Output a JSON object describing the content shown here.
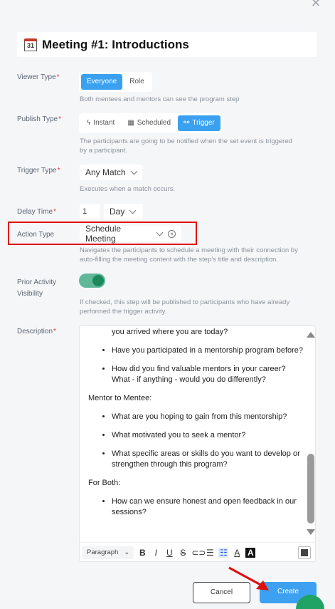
{
  "header": {
    "title": "Meeting #1: Introductions",
    "calendar_day": "31"
  },
  "viewer_type": {
    "label": "Viewer Type",
    "options": [
      "Everyone",
      "Role"
    ],
    "selected": "Everyone",
    "help": "Both mentees and mentors can see the program step"
  },
  "publish_type": {
    "label": "Publish Type",
    "options": [
      "Instant",
      "Scheduled",
      "Trigger"
    ],
    "selected": "Trigger",
    "help_line1": "The participants are going to be notified when the set event is triggered",
    "help_line2": "by a participant."
  },
  "trigger_type": {
    "label": "Trigger Type",
    "value": "Any Match",
    "help": "Executes when a match occurs."
  },
  "delay_time": {
    "label": "Delay Time",
    "number": "1",
    "unit": "Day"
  },
  "action_type": {
    "label": "Action Type",
    "value": "Schedule Meeting",
    "help_line1": "Navigates the participants to schedule a meeting with their connection by",
    "help_line2": "auto-filling the meeting content with the step's title and description."
  },
  "prior_activity": {
    "label_line1": "Prior Activity",
    "label_line2": "Visibility",
    "checked": true,
    "help_line1": "If checked, this step will be published to participants who have already",
    "help_line2": "performed the trigger activity."
  },
  "description": {
    "label": "Description",
    "list1": [
      "Can you share a bit about your background and how you arrived where you are today?",
      "Have you participated in a mentorship program before?",
      "How did you find valuable mentors in your career? What - if anything - would you do differently?"
    ],
    "heading2": "Mentor to Mentee:",
    "list2": [
      "What are you hoping to gain from this mentorship?",
      "What motivated you to seek a mentor?",
      "What specific areas or skills do you want to develop or strengthen through this program?"
    ],
    "heading3": "For Both:",
    "list3": [
      "How can we ensure honest and open feedback in our sessions?"
    ],
    "paragraph_style": "Paragraph"
  },
  "footer": {
    "cancel": "Cancel",
    "create": "Create"
  },
  "colors": {
    "accent": "#3da0f0",
    "annotation": "#e10e0e",
    "toggle": "#1b8a5a"
  }
}
